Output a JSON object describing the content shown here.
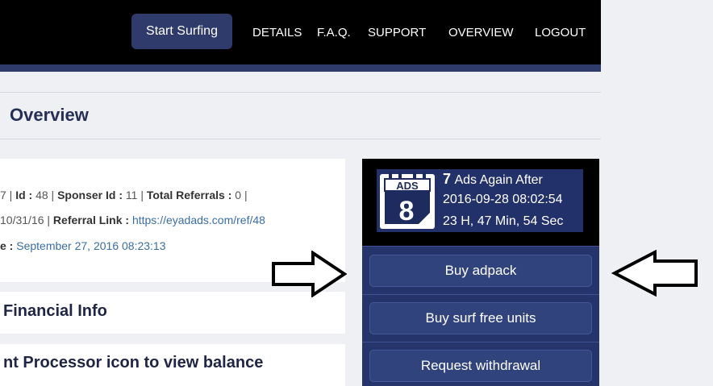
{
  "topnav": {
    "start_surfing": "Start Surfing",
    "details": "DETAILS",
    "faq": "F.A.Q.",
    "support": "SUPPORT",
    "overview": "OVERVIEW",
    "logout": "LOGOUT"
  },
  "page": {
    "title": "Overview"
  },
  "account": {
    "line1": {
      "pre": "7 | ",
      "id_label": "Id :",
      "id_value": " 48 | ",
      "sponsor_label": "Sponser Id :",
      "sponsor_value": " 11 | ",
      "referrals_label": "Total Referrals :",
      "referrals_value": " 0 |"
    },
    "line2": {
      "pre": "10/31/16 | ",
      "ref_label": "Referral Link :",
      "ref_value": " https://eyadads.com/ref/48"
    },
    "line3": {
      "label": "e :",
      "value": " September 27, 2016 08:23:13"
    }
  },
  "sections": {
    "financial_info": "Financial Info",
    "processor_hint": "nt Processor icon to view balance"
  },
  "ads_widget": {
    "calendar_label": "ADS",
    "calendar_number": "8",
    "count": "7",
    "again_after": "Ads Again After",
    "datetime": "2016-09-28 08:02:54",
    "countdown": "23 H, 47 Min, 54 Sec"
  },
  "actions": {
    "buy_adpack": "Buy adpack",
    "buy_surf_free": "Buy surf free units",
    "request_withdrawal": "Request withdrawal"
  },
  "colors": {
    "nav_bg": "#000000",
    "accent": "#2f3b6b",
    "panel": "#25356b",
    "page_bg": "#eef0f4",
    "link": "#3a6ea5"
  }
}
